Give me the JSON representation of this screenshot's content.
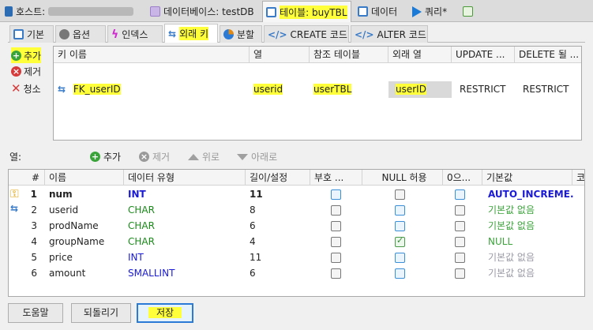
{
  "top_tabs": [
    {
      "label": "호스트:",
      "masked": true
    },
    {
      "label": "데이터베이스: testDB"
    },
    {
      "label": "테이블: buyTBL",
      "active": true
    },
    {
      "label": "데이터"
    },
    {
      "label": "쿼리*"
    }
  ],
  "inner_tabs": [
    "기본",
    "옵션",
    "인덱스",
    "외래 키",
    "분할",
    "CREATE 코드",
    "ALTER 코드"
  ],
  "fk_side": {
    "add": "추가",
    "remove": "제거",
    "clear": "청소"
  },
  "fk_headers": [
    "키 이름",
    "열",
    "참조 테이블",
    "외래 열",
    "UPDATE ...",
    "DELETE 될 ..."
  ],
  "fk_row": {
    "name": "FK_userID",
    "column": "userid",
    "ref_table": "userTBL",
    "foreign_col": "userID",
    "on_update": "RESTRICT",
    "on_delete": "RESTRICT"
  },
  "columns_toolbar": {
    "label": "열:",
    "add": "추가",
    "remove": "제거",
    "up": "위로",
    "down": "아래로"
  },
  "col_headers": [
    "#",
    "이름",
    "데이터 유형",
    "길이/설정",
    "부호 ...",
    "NULL 허용",
    "0으...",
    "기본값",
    "코"
  ],
  "col_rows": [
    {
      "num": "1",
      "name": "num",
      "type": "INT",
      "len": "11",
      "unsigned": false,
      "nullable": false,
      "zerofill": false,
      "default": "AUTO_INCREME...",
      "pk": true
    },
    {
      "num": "2",
      "name": "userid",
      "type": "CHAR",
      "len": "8",
      "unsigned": false,
      "nullable": false,
      "zerofill": false,
      "default": "기본값 없음",
      "fk": true
    },
    {
      "num": "3",
      "name": "prodName",
      "type": "CHAR",
      "len": "6",
      "unsigned": false,
      "nullable": false,
      "zerofill": false,
      "default": "기본값 없음"
    },
    {
      "num": "4",
      "name": "groupName",
      "type": "CHAR",
      "len": "4",
      "unsigned": false,
      "nullable": true,
      "zerofill": false,
      "default": "NULL"
    },
    {
      "num": "5",
      "name": "price",
      "type": "INT",
      "len": "11",
      "unsigned": false,
      "nullable": false,
      "zerofill": false,
      "default": "기본값 없음"
    },
    {
      "num": "6",
      "name": "amount",
      "type": "SMALLINT",
      "len": "6",
      "unsigned": false,
      "nullable": false,
      "zerofill": false,
      "default": "기본값 없음"
    }
  ],
  "bottom_buttons": {
    "help": "도움말",
    "revert": "되돌리기",
    "save": "저장"
  },
  "colors": {
    "type_int": "#1a1ad6",
    "type_char": "#1a8a1a",
    "default_green": "#3aa33a",
    "default_gray": "#9a9aa6",
    "highlight": "#ffff3a"
  }
}
